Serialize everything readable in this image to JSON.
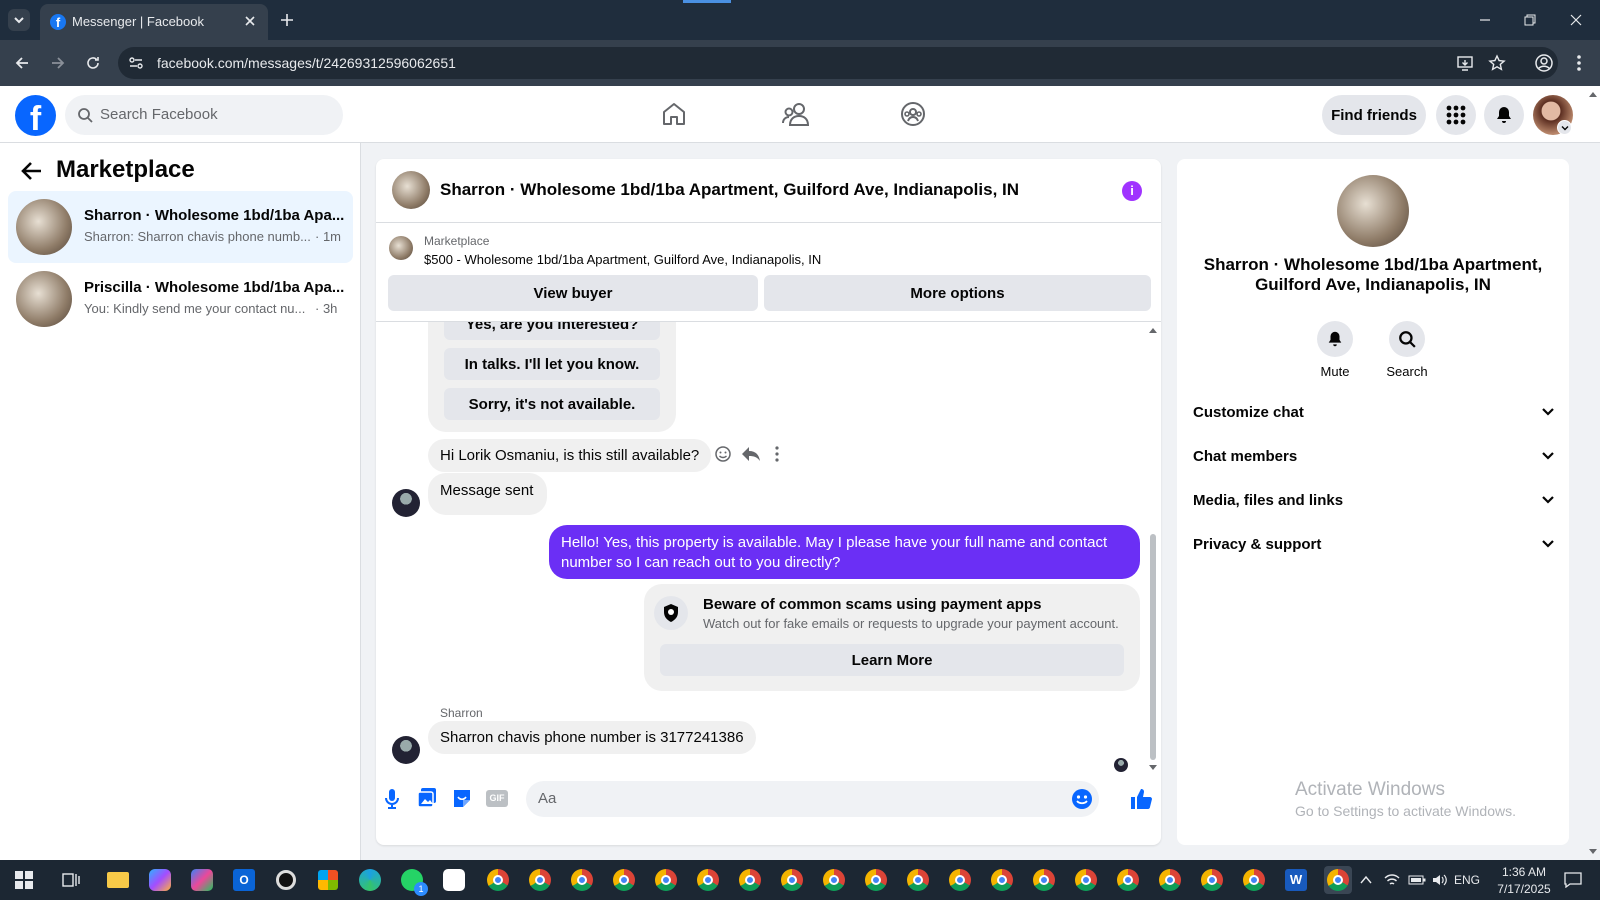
{
  "browser": {
    "tab_title": "Messenger | Facebook",
    "url": "facebook.com/messages/t/24269312596062651"
  },
  "fb": {
    "search_placeholder": "Search Facebook",
    "find_friends": "Find friends"
  },
  "sidebar": {
    "title": "Marketplace",
    "conversations": [
      {
        "name": "Sharron · Wholesome 1bd/1ba Apa...",
        "preview": "Sharron: Sharron chavis phone numb...",
        "time": "· 1m"
      },
      {
        "name": "Priscilla · Wholesome 1bd/1ba Apa...",
        "preview": "You: Kindly send me your contact nu...",
        "time": "· 3h"
      }
    ]
  },
  "chat": {
    "header_title": "Sharron · Wholesome 1bd/1ba Apartment, Guilford Ave, Indianapolis, IN",
    "listing_source": "Marketplace",
    "listing_title": "$500 - Wholesome 1bd/1ba Apartment, Guilford Ave, Indianapolis, IN",
    "view_buyer": "View buyer",
    "more_options": "More options",
    "quick_replies": [
      "Yes, are you interested?",
      "In talks. I'll let you know.",
      "Sorry, it's not available."
    ],
    "msg_question": "Hi Lorik Osmaniu, is this still available?",
    "msg_sent": "Message sent",
    "msg_outgoing": "Hello! Yes, this property is available. May I please have your full name and contact number so I can reach out to you directly?",
    "scam_title": "Beware of common scams using payment apps",
    "scam_body": "Watch out for fake emails or requests to upgrade your payment account.",
    "learn_more": "Learn More",
    "sender_name": "Sharron",
    "msg_last": "Sharron chavis phone number is 3177241386",
    "composer_placeholder": "Aa"
  },
  "info_panel": {
    "title": "Sharron · Wholesome 1bd/1ba Apartment, Guilford Ave, Indianapolis, IN",
    "mute": "Mute",
    "search": "Search",
    "sections": [
      "Customize chat",
      "Chat members",
      "Media, files and links",
      "Privacy & support"
    ]
  },
  "watermark": {
    "line1": "Activate Windows",
    "line2": "Go to Settings to activate Windows."
  },
  "taskbar": {
    "lang": "ENG",
    "time": "1:36 AM",
    "date": "7/17/2025",
    "whatsapp_badge": "1"
  },
  "colors": {
    "accent": "#1877f2",
    "outgoing_bubble": "#6b2ff5",
    "info_icon": "#a033ff"
  }
}
